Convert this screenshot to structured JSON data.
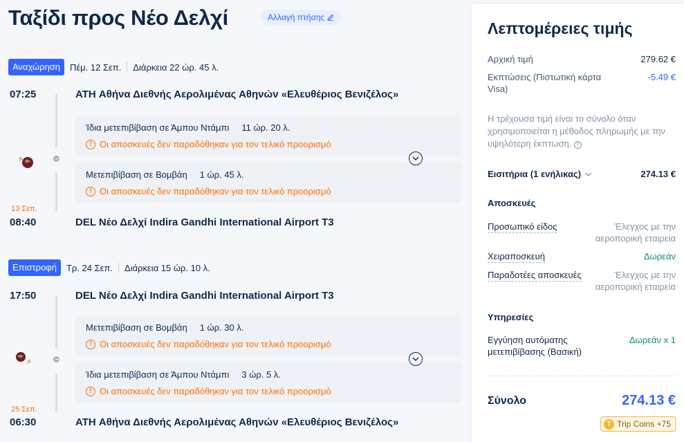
{
  "header": {
    "title": "Ταξίδι προς Νέο Δελχί",
    "change_flight": "Αλλαγή πτήσης"
  },
  "outbound": {
    "badge": "Αναχώρηση",
    "date": "Πέμ. 12 Σεπ.",
    "duration": "Διάρκεια 22 ώρ. 45 λ.",
    "dep_time": "07:25",
    "dep_airport": "ATH Αθήνα Διεθνής Αερολιμένας Αθηνών «Ελευθέριος Βενιζέλος»",
    "arr_date": "13 Σεπ.",
    "arr_time": "08:40",
    "arr_airport": "DEL Νέο Δελχί Indira Gandhi International Airport T3",
    "stops": [
      {
        "label": "Ίδια μετεπιβίβαση σε Άμπου Ντάμπι",
        "duration": "11 ώρ. 20 λ.",
        "warning": "Οι αποσκευές δεν παραδόθηκαν για τον τελικό προορισμό"
      },
      {
        "label": "Μετεπιβίβαση σε Βομβάη",
        "duration": "1 ώρ. 45 λ.",
        "warning": "Οι αποσκευές δεν παραδόθηκαν για τον τελικό προορισμό"
      }
    ]
  },
  "return": {
    "badge": "Επιστροφή",
    "date": "Τρ. 24 Σεπ.",
    "duration": "Διάρκεια 15 ώρ. 10 λ.",
    "dep_time": "17:50",
    "dep_airport": "DEL Νέο Δελχί Indira Gandhi International Airport T3",
    "arr_date": "25 Σεπ.",
    "arr_time": "06:30",
    "arr_airport": "ATH Αθήνα Διεθνής Αερολιμένας Αθηνών «Ελευθέριος Βενιζέλος»",
    "stops": [
      {
        "label": "Μετεπιβίβαση σε Βομβάη",
        "duration": "1 ώρ. 30 λ.",
        "warning": "Οι αποσκευές δεν παραδόθηκαν για τον τελικό προορισμό"
      },
      {
        "label": "Ίδια μετεπιβίβαση σε Άμπου Ντάμπι",
        "duration": "3 ώρ. 5 λ.",
        "warning": "Οι αποσκευές δεν παραδόθηκαν για τον τελικό προορισμό"
      }
    ]
  },
  "price": {
    "title": "Λεπτομέρειες τιμής",
    "base_label": "Αρχική τιμή",
    "base_value": "279.62 €",
    "discount_label": "Εκπτώσεις (Πιστωτική κάρτα Visa)",
    "discount_value": "-5.49 €",
    "note": "Η τρέχουσα τιμή είναι το σύνολο όταν χρησιμοποιείται η μέθοδος πληρωμής με την υψηλότερη έκπτωση.",
    "tickets_label": "Εισιτήρια (1 ενήλικας)",
    "tickets_value": "274.13 €",
    "baggage_title": "Αποσκευές",
    "personal_label": "Προσωπικό είδος",
    "personal_value": "Έλεγχος με την αεροπορική εταιρεία",
    "hand_label": "Χειραποσκευή",
    "hand_value": "Δωρεάν",
    "checked_label": "Παραδοτέες αποσκευές",
    "checked_value": "Έλεγχος με την αεροπορική εταιρεία",
    "services_title": "Υπηρεσίες",
    "guarantee_label": "Εγγύηση αυτόματης μετεπιβίβασης (Βασική)",
    "guarantee_value": "Δωρεάν x 1",
    "total_label": "Σύνολο",
    "total_value": "274.13 €",
    "coins": "Trip Coins +75"
  },
  "colors": {
    "accent": "#3264ff",
    "warning": "#ff6f00",
    "free": "#0d8a7f",
    "text": "#0f294d"
  }
}
